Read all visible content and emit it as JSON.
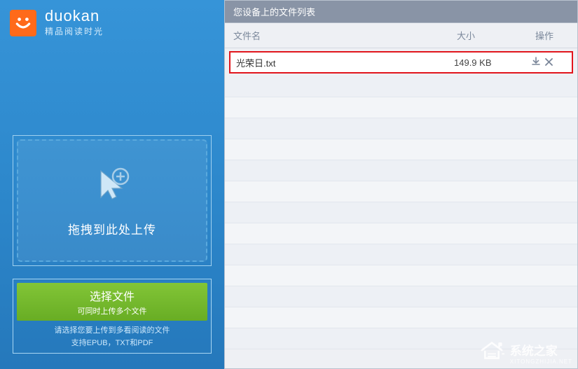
{
  "brand": {
    "wordmark": "duokan",
    "tagline": "精品阅读时光"
  },
  "dropzone": {
    "text": "拖拽到此处上传"
  },
  "select_button": {
    "primary": "选择文件",
    "secondary": "可同时上传多个文件"
  },
  "upload_hint": {
    "line1": "请选择您要上传到多看阅读的文件",
    "line2": "支持EPUB，TXT和PDF"
  },
  "main": {
    "title": "您设备上的文件列表",
    "columns": {
      "name": "文件名",
      "size": "大小",
      "ops": "操作"
    }
  },
  "files": [
    {
      "name": "光荣日.txt",
      "size": "149.9 KB"
    }
  ],
  "watermark": {
    "primary": "系统之家",
    "sub": "XITONGZHIJIA.NET"
  }
}
